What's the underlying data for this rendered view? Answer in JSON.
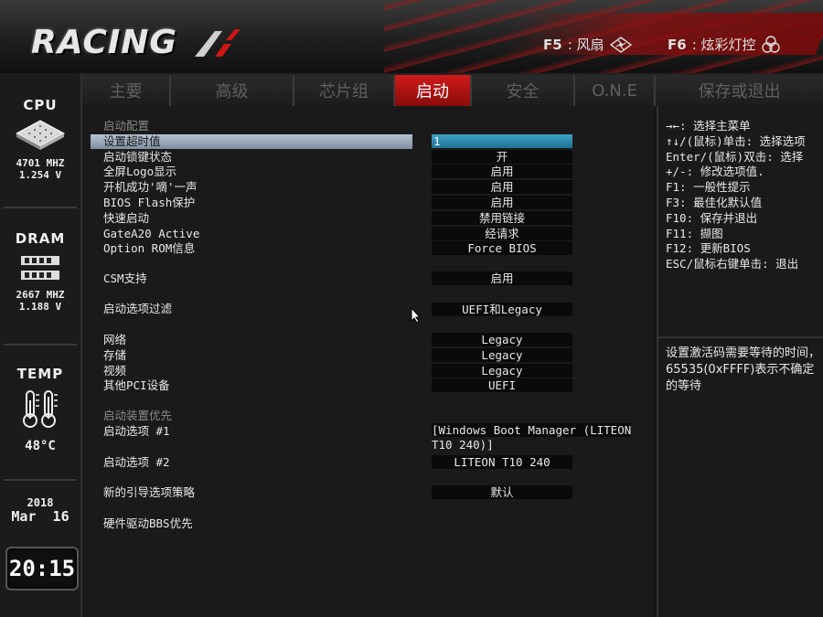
{
  "header": {
    "logo": "RACING",
    "f5": {
      "key": "F5",
      "label": ": 风扇",
      "icon": "fan-icon"
    },
    "f6": {
      "key": "F6",
      "label": ": 炫彩灯控",
      "icon": "led-icon"
    }
  },
  "sidebar": {
    "cpu": {
      "title": "CPU",
      "freq": "4701 MHZ",
      "volt": "1.254 V"
    },
    "dram": {
      "title": "DRAM",
      "freq": "2667 MHZ",
      "volt": "1.188 V"
    },
    "temp": {
      "title": "TEMP",
      "value": "48°C"
    },
    "date": {
      "year": "2018",
      "month_day": "Mar  16"
    },
    "time": "20:15"
  },
  "tabs": [
    {
      "label": "主要"
    },
    {
      "label": "高级"
    },
    {
      "label": "芯片组"
    },
    {
      "label": "启动",
      "active": true
    },
    {
      "label": "安全"
    },
    {
      "label": "O.N.E"
    },
    {
      "label": "保存或退出"
    }
  ],
  "main": {
    "section_boot_config": "启动配置",
    "items": [
      {
        "label": "设置超时值",
        "value": "1"
      },
      {
        "label": "启动锁键状态",
        "value": "开"
      },
      {
        "label": "全屏Logo显示",
        "value": "启用"
      },
      {
        "label": "开机成功'嘀'一声",
        "value": "启用"
      },
      {
        "label": "BIOS Flash保护",
        "value": "启用"
      },
      {
        "label": "快速启动",
        "value": "禁用链接"
      },
      {
        "label": "GateA20 Active",
        "value": "经请求"
      },
      {
        "label": "Option ROM信息",
        "value": "Force BIOS"
      },
      {
        "label": "CSM支持",
        "value": "启用"
      },
      {
        "label": "启动选项过滤",
        "value": "UEFI和Legacy"
      },
      {
        "label": "网络",
        "value": "Legacy"
      },
      {
        "label": "存储",
        "value": "Legacy"
      },
      {
        "label": "视频",
        "value": "Legacy"
      },
      {
        "label": "其他PCI设备",
        "value": "UEFI"
      }
    ],
    "section_boot_priority": "启动装置优先",
    "boot_options": [
      {
        "label": "启动选项 #1",
        "value_line1": "[Windows Boot Manager (LITEON",
        "value_line2": "T10 240)]"
      },
      {
        "label": "启动选项 #2",
        "value": "LITEON T10 240"
      }
    ],
    "new_boot_policy": {
      "label": "新的引导选项策略",
      "value": "默认"
    },
    "hdd_bbs": {
      "label": "硬件驱动BBS优先"
    }
  },
  "help": {
    "keys": [
      "→←: 选择主菜单",
      "↑↓/(鼠标)单击: 选择选项",
      "Enter/(鼠标)双击: 选择",
      "+/-: 修改选项值.",
      "F1: 一般性提示",
      "F3: 最佳化默认值",
      "F10: 保存并退出",
      "F11: 撷图",
      "F12: 更新BIOS",
      "ESC/鼠标右键单击: 退出"
    ],
    "description": "设置激活码需要等待的时间，65535(0xFFFF)表示不确定的等待"
  },
  "colors": {
    "accent": "#c01515",
    "selected_value": "#2f8fb5",
    "selected_row": "#9aa8b8"
  }
}
